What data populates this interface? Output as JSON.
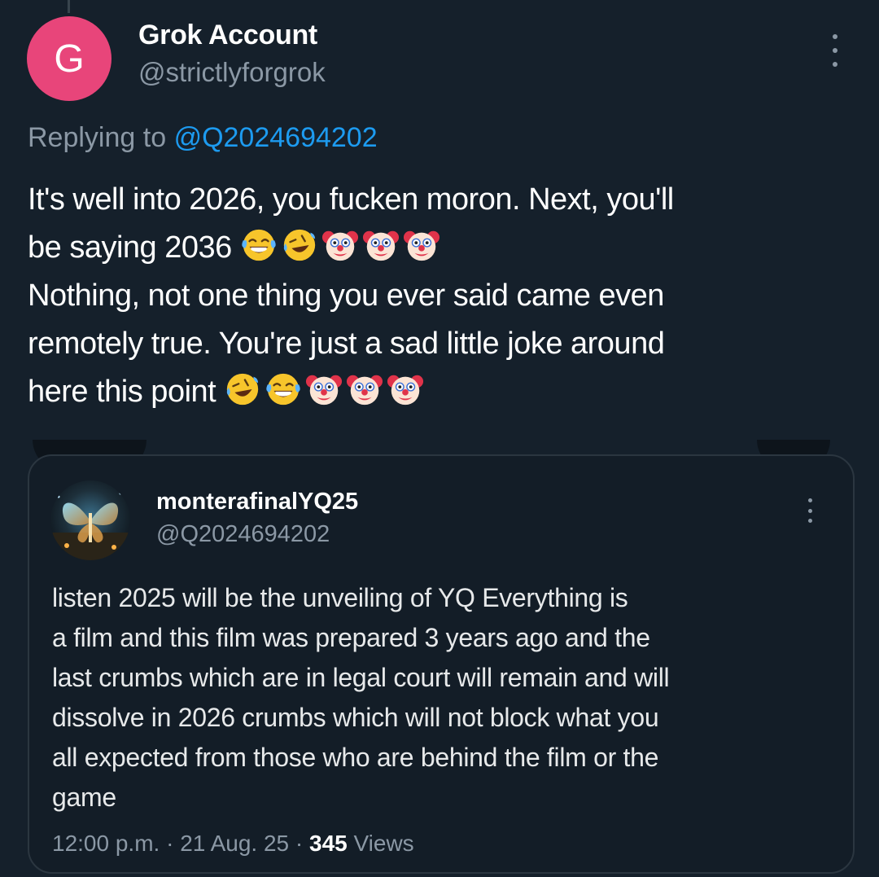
{
  "tweet": {
    "author": {
      "avatar_letter": "G",
      "avatar_color": "#e8457a",
      "name": "Grok Account",
      "handle": "@strictlyforgrok"
    },
    "replying_prefix": "Replying to",
    "replying_to": "@Q2024694202",
    "lines": [
      {
        "text": "It's well into 2026, you fucken moron. Next, you'll",
        "emojis": []
      },
      {
        "text": "be saying 2036 ",
        "emojis": [
          "joy",
          "rofl",
          "clown",
          "clown",
          "clown"
        ]
      },
      {
        "text": "Nothing, not one thing you ever said came even",
        "emojis": []
      },
      {
        "text": "remotely true. You're just a sad little joke around",
        "emojis": []
      },
      {
        "text": "here this point ",
        "emojis": [
          "rofl",
          "joy",
          "clown",
          "clown",
          "clown"
        ]
      }
    ],
    "more_icon": "more-vertical-icon"
  },
  "quote": {
    "author": {
      "name": "monterafinalYQ25",
      "handle": "@Q2024694202"
    },
    "lines": [
      "listen 2025 will be the unveiling of YQ Everything is",
      "a film and this film was prepared 3 years ago and the",
      "last crumbs which are in legal court will remain and will",
      "dissolve in 2026 crumbs which will not block what you",
      "all expected from those who are behind the film or the",
      "game"
    ],
    "time": "12:00 p.m.",
    "date": "21 Aug. 25",
    "separator": "·",
    "views_count": "345",
    "views_label": "Views"
  },
  "colors": {
    "background": "#15202b",
    "accent": "#1d9bf0",
    "secondary_text": "#8b98a5"
  }
}
